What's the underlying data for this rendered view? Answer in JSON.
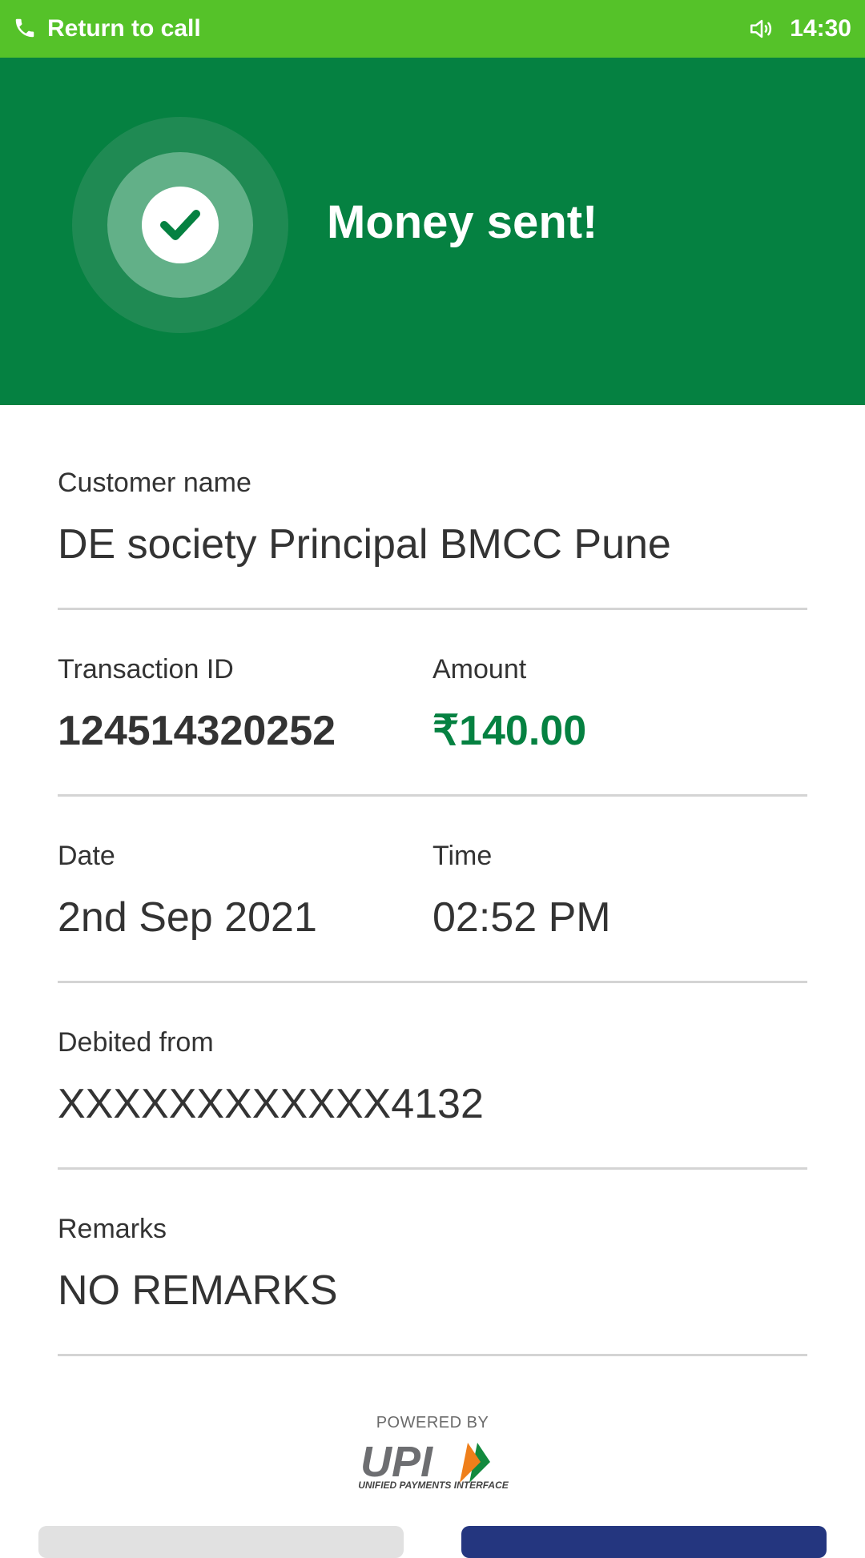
{
  "status_bar": {
    "return_label": "Return to call",
    "time": "14:30",
    "icons": [
      "phone-icon",
      "speaker-icon"
    ],
    "background": "#55c229"
  },
  "header": {
    "title": "Money sent!",
    "icon": "check-icon",
    "background": "#058141"
  },
  "details": {
    "customer_name": {
      "label": "Customer name",
      "value": "DE society Principal BMCC Pune"
    },
    "transaction_id": {
      "label": "Transaction ID",
      "value": "124514320252"
    },
    "amount": {
      "label": "Amount",
      "value": "₹140.00",
      "color": "#058141"
    },
    "date": {
      "label": "Date",
      "value": "2nd Sep 2021"
    },
    "time": {
      "label": "Time",
      "value": "02:52 PM"
    },
    "debited_from": {
      "label": "Debited from",
      "value": "XXXXXXXXXXXX4132"
    },
    "remarks": {
      "label": "Remarks",
      "value": "NO REMARKS"
    }
  },
  "footer": {
    "powered_by": "POWERED BY",
    "logo_text": "UPI",
    "logo_tagline": "UNIFIED PAYMENTS INTERFACE"
  }
}
